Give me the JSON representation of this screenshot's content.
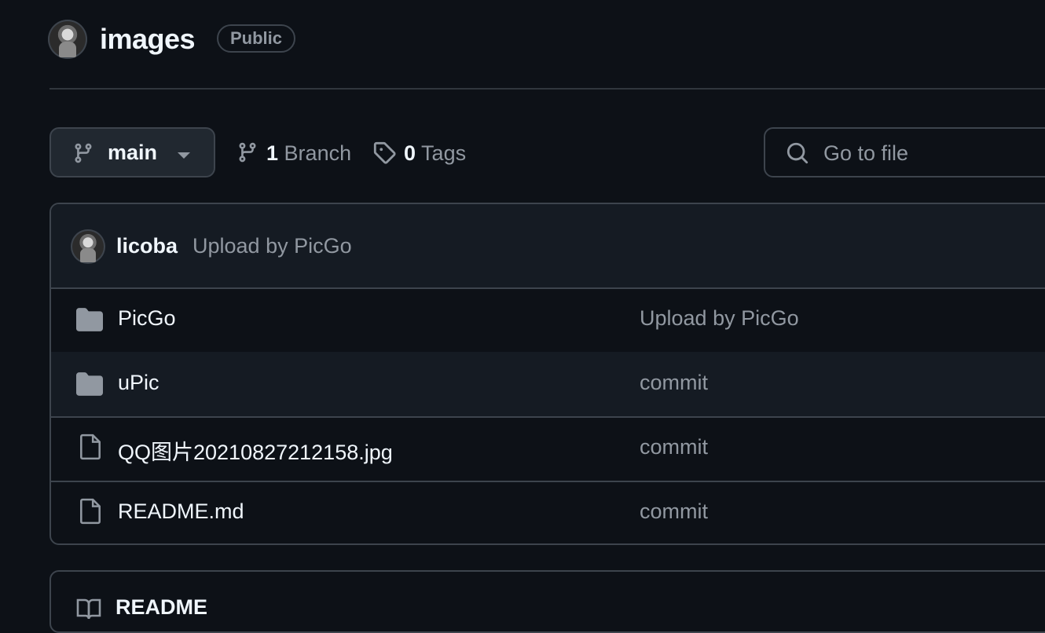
{
  "repo": {
    "name": "images",
    "visibility": "Public"
  },
  "toolbar": {
    "branch_name": "main",
    "branch_count": "1",
    "branch_label": "Branch",
    "tag_count": "0",
    "tag_label": "Tags",
    "goto_file_placeholder": "Go to file"
  },
  "latest_commit": {
    "author": "licoba",
    "message": "Upload by PicGo"
  },
  "files": [
    {
      "name": "PicGo",
      "type": "folder",
      "message": "Upload by PicGo"
    },
    {
      "name": "uPic",
      "type": "folder",
      "message": "commit"
    },
    {
      "name": "QQ图片20210827212158.jpg",
      "type": "file",
      "message": "commit"
    },
    {
      "name": "README.md",
      "type": "file",
      "message": "commit"
    }
  ],
  "readme": {
    "title": "README"
  },
  "icons": {
    "branch": "git-branch-icon",
    "tag": "tag-icon",
    "search": "search-icon",
    "folder": "folder-icon",
    "file": "file-icon",
    "book": "book-icon",
    "caret": "caret-down-icon"
  },
  "colors": {
    "background": "#0d1117",
    "border": "#3d444d",
    "muted_text": "#9198a1",
    "folder_icon": "#9198a1"
  }
}
